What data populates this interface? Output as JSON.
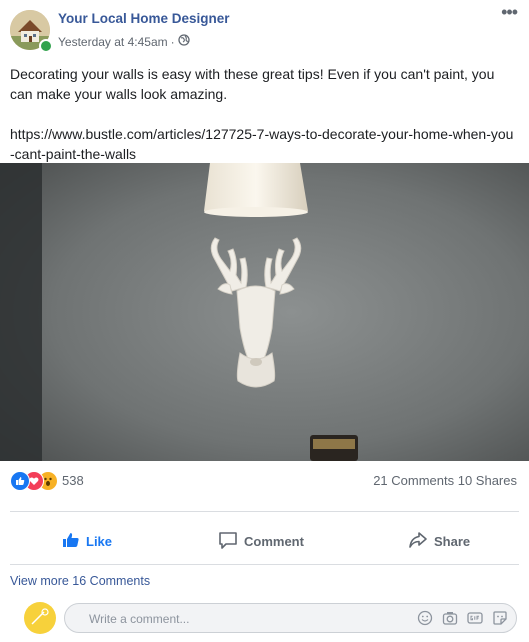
{
  "post": {
    "page_name": "Your Local Home Designer",
    "timestamp": "Yesterday at 4:45am",
    "separator": "·",
    "privacy_icon": "globe-icon",
    "body_text": "Decorating your walls is easy with these great tips! Even if you can't paint, you can make your walls look amazing.",
    "link_text": "https://www.bustle.com/articles/127725-7-ways-to-decorate-your-home-when-you-cant-paint-the-walls"
  },
  "reactions": {
    "types": [
      "like",
      "love",
      "wow"
    ],
    "count": "538",
    "comments": "21 Comments",
    "shares": "10 Shares"
  },
  "actions": {
    "like": "Like",
    "comment": "Comment",
    "share": "Share"
  },
  "comments": {
    "view_more": "View more 16 Comments",
    "placeholder": "Write a comment..."
  },
  "colors": {
    "brand_blue": "#385898",
    "like_blue": "#1877f2",
    "love_red": "#f33e58",
    "wow_yellow": "#f7b125",
    "online_green": "#31a24c"
  }
}
